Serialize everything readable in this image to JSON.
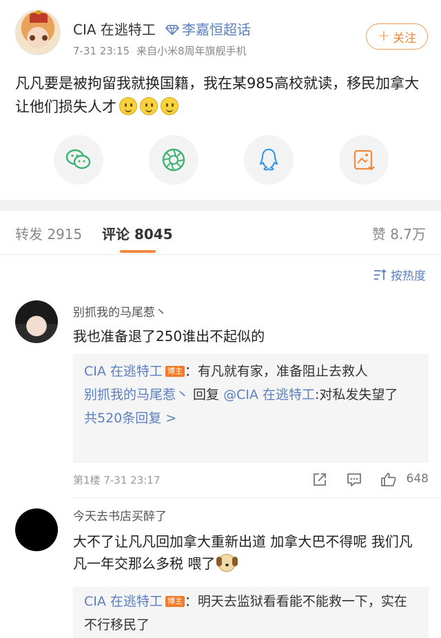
{
  "post": {
    "author": "CIA 在逃特工",
    "topic": "李嘉恒超话",
    "time": "7-31 23:15",
    "source": "来自小米8周年旗舰手机",
    "follow_label": "关注",
    "text": "凡凡要是被拘留我就换国籍，我在某985高校就读，移民加拿大让他们损失人才"
  },
  "share": {
    "items": [
      {
        "name": "wechat-icon",
        "color": "#3cb371"
      },
      {
        "name": "moments-icon",
        "color": "#3cb371"
      },
      {
        "name": "qq-icon",
        "color": "#3b9ae1"
      },
      {
        "name": "save-image-icon",
        "color": "#f08a3c"
      }
    ]
  },
  "tabs": {
    "repost_label": "转发",
    "repost_count": "2915",
    "comment_label": "评论",
    "comment_count": "8045",
    "like_label": "赞",
    "like_count": "8.7万"
  },
  "sort": {
    "label": "按热度"
  },
  "comments": [
    {
      "user": "别抓我的马尾惹丶",
      "text": "我也准备退了250谁出不起似的",
      "replies": [
        {
          "user": "CIA 在逃特工",
          "badge": "博主",
          "text": "：有凡就有家，准备阻止去救人"
        },
        {
          "user": "别抓我的马尾惹丶",
          "mid": " 回复 ",
          "at": "@CIA 在逃特工",
          "text": ":对私发失望了"
        }
      ],
      "more": "共520条回复 >",
      "floor": "第1楼",
      "time": "7-31 23:17",
      "likes": "648"
    },
    {
      "user": "今天去书店买醉了",
      "text": "大不了让凡凡回加拿大重新出道 加拿大巴不得呢 我们凡凡一年交那么多税 喂了",
      "replies": [
        {
          "user": "CIA 在逃特工",
          "badge": "博主",
          "text": "：明天去监狱看看能不能救一下，实在不行移民了"
        }
      ]
    }
  ]
}
